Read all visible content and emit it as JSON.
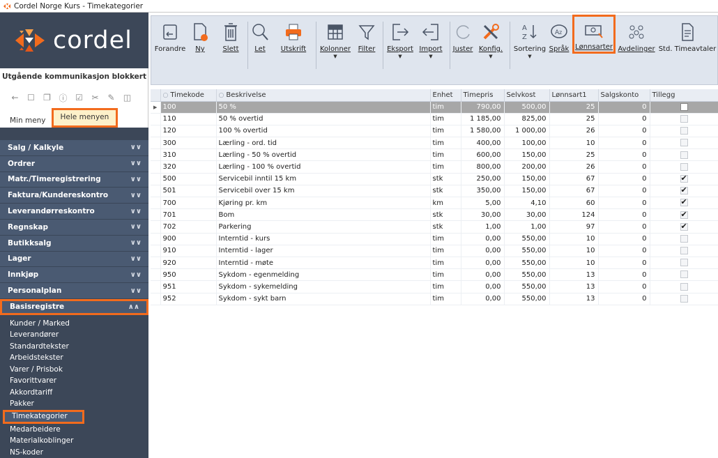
{
  "window": {
    "title": "Cordel Norge Kurs - Timekategorier"
  },
  "brand": {
    "logo_text": "cordel"
  },
  "sidebar": {
    "status_label": "Utgående kommunikasjon blokkert",
    "tabs": {
      "min": "Min meny",
      "hele": "Hele menyen"
    },
    "groups": [
      "Salg / Kalkyle",
      "Ordrer",
      "Matr./Timeregistrering",
      "Faktura/Kundereskontro",
      "Leverandørreskontro",
      "Regnskap",
      "Butikksalg",
      "Lager",
      "Innkjøp",
      "Personalplan",
      "Basisregistre"
    ],
    "subitems": [
      "Kunder / Marked",
      "Leverandører",
      "Standardtekster",
      "Arbeidstekster",
      "Varer / Prisbok",
      "Favorittvarer",
      "Akkordtariff",
      "Pakker",
      "Timekategorier",
      "Medarbeidere",
      "Materialkoblinger",
      "NS-koder"
    ]
  },
  "toolbar": {
    "forandre": "Forandre",
    "ny": "Ny",
    "slett": "Slett",
    "let": "Let",
    "utskrift": "Utskrift",
    "kolonner": "Kolonner",
    "filter": "Filter",
    "eksport": "Eksport",
    "import": "Import",
    "juster": "Juster",
    "konfig": "Konfig.",
    "sortering": "Sortering",
    "sprak": "Språk",
    "lonnsarter": "Lønnsarter",
    "avdelinger": "Avdelinger",
    "stdtimeavtaler": "Std. Timeavtaler"
  },
  "table": {
    "columns": [
      "Timekode",
      "Beskrivelse",
      "Enhet",
      "Timepris",
      "Selvkost",
      "Lønnsart1",
      "Salgskonto",
      "Tillegg"
    ],
    "rows": [
      {
        "kode": "100",
        "beskrivelse": "50 %",
        "enhet": "tim",
        "timepris": "790,00",
        "selvkost": "500,00",
        "lonnsart": "25",
        "salgskonto": "0",
        "tillegg": false
      },
      {
        "kode": "110",
        "beskrivelse": "50 % overtid",
        "enhet": "tim",
        "timepris": "1 185,00",
        "selvkost": "825,00",
        "lonnsart": "25",
        "salgskonto": "0",
        "tillegg": false
      },
      {
        "kode": "120",
        "beskrivelse": "100 % overtid",
        "enhet": "tim",
        "timepris": "1 580,00",
        "selvkost": "1 000,00",
        "lonnsart": "26",
        "salgskonto": "0",
        "tillegg": false
      },
      {
        "kode": "300",
        "beskrivelse": "Lærling - ord. tid",
        "enhet": "tim",
        "timepris": "400,00",
        "selvkost": "100,00",
        "lonnsart": "10",
        "salgskonto": "0",
        "tillegg": false
      },
      {
        "kode": "310",
        "beskrivelse": "Lærling - 50 % overtid",
        "enhet": "tim",
        "timepris": "600,00",
        "selvkost": "150,00",
        "lonnsart": "25",
        "salgskonto": "0",
        "tillegg": false
      },
      {
        "kode": "320",
        "beskrivelse": "Lærling - 100 % overtid",
        "enhet": "tim",
        "timepris": "800,00",
        "selvkost": "200,00",
        "lonnsart": "26",
        "salgskonto": "0",
        "tillegg": false
      },
      {
        "kode": "500",
        "beskrivelse": "Servicebil inntil 15 km",
        "enhet": "stk",
        "timepris": "250,00",
        "selvkost": "150,00",
        "lonnsart": "67",
        "salgskonto": "0",
        "tillegg": true
      },
      {
        "kode": "501",
        "beskrivelse": "Servicebil over 15 km",
        "enhet": "stk",
        "timepris": "350,00",
        "selvkost": "150,00",
        "lonnsart": "67",
        "salgskonto": "0",
        "tillegg": true
      },
      {
        "kode": "700",
        "beskrivelse": "Kjøring pr. km",
        "enhet": "km",
        "timepris": "5,00",
        "selvkost": "4,10",
        "lonnsart": "60",
        "salgskonto": "0",
        "tillegg": true
      },
      {
        "kode": "701",
        "beskrivelse": "Bom",
        "enhet": "stk",
        "timepris": "30,00",
        "selvkost": "30,00",
        "lonnsart": "124",
        "salgskonto": "0",
        "tillegg": true
      },
      {
        "kode": "702",
        "beskrivelse": "Parkering",
        "enhet": "stk",
        "timepris": "1,00",
        "selvkost": "1,00",
        "lonnsart": "97",
        "salgskonto": "0",
        "tillegg": true
      },
      {
        "kode": "900",
        "beskrivelse": "Interntid - kurs",
        "enhet": "tim",
        "timepris": "0,00",
        "selvkost": "550,00",
        "lonnsart": "10",
        "salgskonto": "0",
        "tillegg": false
      },
      {
        "kode": "910",
        "beskrivelse": "Interntid - lager",
        "enhet": "tim",
        "timepris": "0,00",
        "selvkost": "550,00",
        "lonnsart": "10",
        "salgskonto": "0",
        "tillegg": false
      },
      {
        "kode": "920",
        "beskrivelse": "Interntid - møte",
        "enhet": "tim",
        "timepris": "0,00",
        "selvkost": "550,00",
        "lonnsart": "10",
        "salgskonto": "0",
        "tillegg": false
      },
      {
        "kode": "950",
        "beskrivelse": "Sykdom - egenmelding",
        "enhet": "tim",
        "timepris": "0,00",
        "selvkost": "550,00",
        "lonnsart": "13",
        "salgskonto": "0",
        "tillegg": false
      },
      {
        "kode": "951",
        "beskrivelse": "Sykdom - sykemelding",
        "enhet": "tim",
        "timepris": "0,00",
        "selvkost": "550,00",
        "lonnsart": "13",
        "salgskonto": "0",
        "tillegg": false
      },
      {
        "kode": "952",
        "beskrivelse": "Sykdom - sykt barn",
        "enhet": "tim",
        "timepris": "0,00",
        "selvkost": "550,00",
        "lonnsart": "13",
        "salgskonto": "0",
        "tillegg": false
      }
    ]
  },
  "colors": {
    "accent": "#f26b1d",
    "sidebar": "#3c4758",
    "group": "#4a5a72",
    "selected_row": "#a7a7a7",
    "toolbar": "#dfe5ee"
  }
}
